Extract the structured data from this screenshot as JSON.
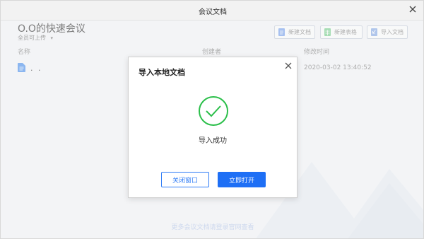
{
  "window": {
    "title": "会议文档"
  },
  "header": {
    "meeting_title": "O.O的快速会议",
    "uploader_label": "全员可上传",
    "buttons": [
      {
        "label": "新建文档",
        "icon": "doc-icon"
      },
      {
        "label": "新建表格",
        "icon": "sheet-icon"
      },
      {
        "label": "导入文档",
        "icon": "import-icon"
      }
    ]
  },
  "table": {
    "columns": [
      "名称",
      "创建者",
      "修改时间"
    ],
    "rows": [
      {
        "name": ". .",
        "creator": "",
        "modified": "2020-03-02 13:40:52"
      }
    ]
  },
  "footer": {
    "link_text": "更多会议文档请登录官网查看"
  },
  "dialog": {
    "title": "导入本地文档",
    "message": "导入成功",
    "close_button": "关闭窗口",
    "open_button": "立即打开"
  },
  "colors": {
    "accent": "#1e6ff5",
    "success": "#2bbf4a"
  }
}
